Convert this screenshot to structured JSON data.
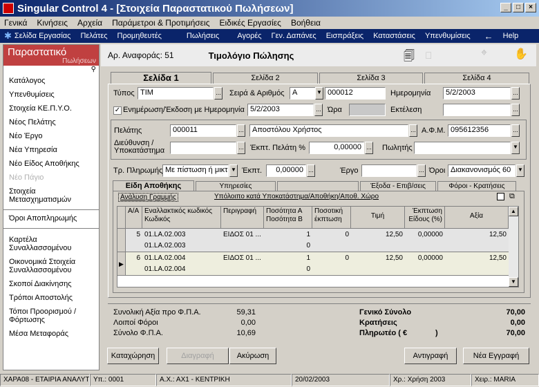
{
  "window": {
    "title": "Singular Control 4 - [Στοιχεία Παραστατικού Πωλήσεων]"
  },
  "menu": [
    "Γενικά",
    "Κινήσεις",
    "Αρχεία",
    "Παράμετροι & Προτιμήσεις",
    "Ειδικές Εργασίες",
    "Βοήθεια"
  ],
  "toolbar": {
    "items": [
      "Σελίδα Εργασίας",
      "Πελάτες",
      "Προμηθευτές",
      "Πωλήσεις",
      "Αγορές",
      "Γεν. Δαπάνες",
      "Εισπράξεις",
      "Καταστάσεις",
      "Υπενθυμίσεις"
    ],
    "help": "Help"
  },
  "left": {
    "title": "Παραστατικό",
    "subtitle": "Πωλήσεων",
    "items": [
      "Κατάλογος",
      "Υπενθυμίσεις",
      "Στοιχεία ΚΕ.Π.Υ.Ο.",
      "Νέος Πελάτης",
      "Νέο Έργο",
      "Νέα Υπηρεσία",
      "Νέο Είδος Αποθήκης",
      "Νέο Πάγιο",
      "Στοιχεία Μετασχηματισμών",
      "Όροι Αποπληρωμής",
      "Καρτέλα Συναλλασσομένου",
      "Οικονομικά Στοιχεία Συναλλασσομένου",
      "Σκοποί Διακίνησης",
      "Τρόποι Αποστολής",
      "Τόποι Προορισμού / Φόρτωσης",
      "Μέσα Μεταφοράς"
    ]
  },
  "header": {
    "ref_label": "Αρ. Αναφοράς: 51",
    "doc_title": "Τιμολόγιο Πώλησης"
  },
  "tabs": [
    "Σελίδα 1",
    "Σελίδα 2",
    "Σελίδα 3",
    "Σελίδα 4"
  ],
  "form": {
    "type_label": "Τύπος",
    "type_value": "ΤΙΜ",
    "series_label": "Σειρά & Αριθμός",
    "series_value": "Α",
    "number_value": "000012",
    "date_label": "Ημερομηνία",
    "date_value": "5/2/2003",
    "update_label": "Ενημέρωση/Έκδοση με Ημερομηνία",
    "update_value": "5/2/2003",
    "time_label": "Ώρα",
    "exec_label": "Εκτέλεση",
    "customer_label": "Πελάτης",
    "customer_code": "000011",
    "customer_name": "Αποστόλου Χρήστος",
    "afm_label": "Α.Φ.Μ.",
    "afm_value": "095612356",
    "address_label": "Διεύθυνση / Υποκατάστημα",
    "discount_label": "Έκπτ. Πελάτη %",
    "discount_value": "0,00000",
    "seller_label": "Πωλητής",
    "payment_label": "Τρ. Πληρωμής",
    "payment_value": "Με πίστωση ή μικτ",
    "disc2_label": "Έκπτ.",
    "disc2_value": "0,00000",
    "project_label": "Έργο",
    "terms_label": "Όροι",
    "terms_value": "Διακανονισμός 60"
  },
  "subtabs": [
    "Είδη Αποθήκης",
    "Υπηρεσίες",
    "",
    "Έξοδα - Επιβ/σεις",
    "Φόροι - Κρατήσεις"
  ],
  "sublinks": {
    "a": "Ανάλυση Γραμμής",
    "b": "Υπόλοιπο κατά Υποκατάστημα/Αποθήκη/Αποθ. Χώρο"
  },
  "grid": {
    "headers": [
      "Α/Α",
      "Εναλλακτικός κωδικός Κωδικός",
      "Περιγραφή",
      "Ποσότητα Α Ποσότητα Β",
      "Ποσοτική έκπτωση",
      "Τιμή",
      "Έκπτωση Είδους (%)",
      "Αξία"
    ],
    "rows": [
      {
        "aa": "5",
        "alt": "01.LA.02.003",
        "code": "01.LA.02.003",
        "desc": "ΕΙΔΟΣ 01 ...",
        "qa": "1",
        "qb": "0",
        "qd": "0",
        "price": "12,50",
        "disc": "0,00000",
        "value": "12,50"
      },
      {
        "aa": "6",
        "alt": "01.LA.02.004",
        "code": "01.LA.02.004",
        "desc": "ΕΙΔΟΣ 01 ...",
        "qa": "1",
        "qb": "0",
        "qd": "0",
        "price": "12,50",
        "disc": "0,00000",
        "value": "12,50"
      }
    ]
  },
  "totals": {
    "net_label": "Συνολική Αξία προ Φ.Π.Α.",
    "net_value": "59,31",
    "other_label": "Λοιποί Φόροι",
    "other_value": "0,00",
    "vat_label": "Σύνολο Φ.Π.Α.",
    "vat_value": "10,69",
    "grand_label": "Γενικό Σύνολο",
    "grand_value": "70,00",
    "ret_label": "Κρατήσεις",
    "ret_value": "0,00",
    "pay_label": "Πληρωτέο ( €",
    "pay_value": "70,00",
    "pay_close": ")"
  },
  "buttons": {
    "save": "Καταχώρηση",
    "delete": "Διαγραφή",
    "cancel": "Ακύρωση",
    "copy": "Αντιγραφή",
    "new": "Νέα Εγγραφή"
  },
  "status": [
    "ΧΑΡΑ08 - ΕΤΑΙΡΙΑ ΑΝΑΛΥΤΙ",
    "Υπ.: 0001",
    "Α.Χ.: ΑΧ1 - ΚΕΝΤΡΙΚΗ",
    "20/02/2003",
    "Χρ.: Χρήση 2003",
    "Χειρ.: MARIA"
  ]
}
